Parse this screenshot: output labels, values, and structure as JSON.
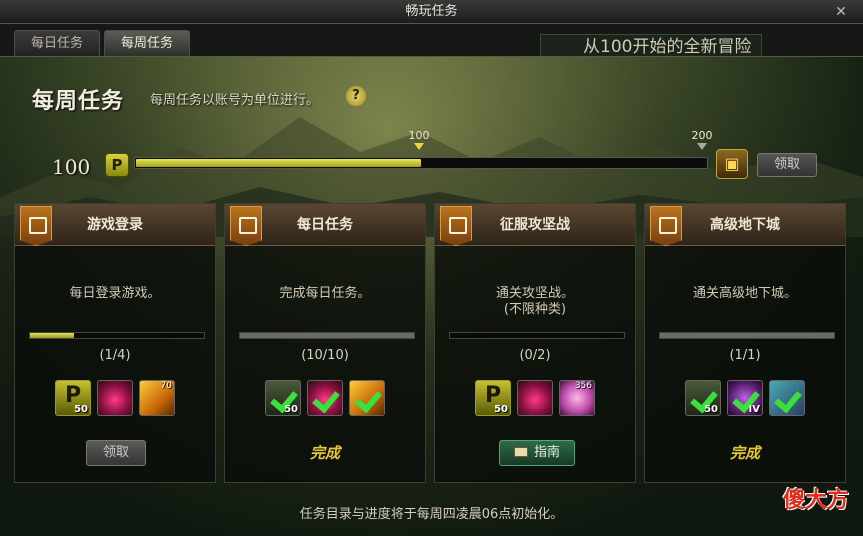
{
  "window": {
    "title": "畅玩任务",
    "close_glyph": "✕"
  },
  "tabs": [
    {
      "label": "每日任务"
    },
    {
      "label": "每周任务"
    }
  ],
  "banner_fragment": "从100开始的全新冒险",
  "weekly": {
    "heading": "每周任务",
    "subtitle": "每周任务以账号为单位进行。",
    "help_glyph": "?",
    "progress_value": "100",
    "points_icon_text": "P",
    "progress_fraction": 0.5,
    "marker_100": "100",
    "marker_200": "200",
    "chest_glyph": "▣",
    "claim_label": "领取"
  },
  "cards": [
    {
      "title": "游戏登录",
      "desc_line1": "每日登录游戏。",
      "desc_line2": "",
      "count": "(1/4)",
      "progress": 0.25,
      "rewards": [
        {
          "type": "points",
          "qty": "50"
        },
        {
          "type": "gem",
          "qty": ""
        },
        {
          "type": "gold",
          "qty": "70"
        }
      ],
      "action_label": "领取"
    },
    {
      "title": "每日任务",
      "desc_line1": "完成每日任务。",
      "desc_line2": "",
      "count": "(10/10)",
      "progress": 1.0,
      "rewards": [
        {
          "type": "done",
          "qty": "50"
        },
        {
          "type": "done"
        },
        {
          "type": "done"
        }
      ],
      "action_label": "完成"
    },
    {
      "title": "征服攻坚战",
      "desc_line1": "通关攻坚战。",
      "desc_line2": "(不限种类)",
      "count": "(0/2)",
      "progress": 0.0,
      "rewards": [
        {
          "type": "points",
          "qty": "50"
        },
        {
          "type": "gem",
          "qty": ""
        },
        {
          "type": "pink",
          "qty": "356"
        }
      ],
      "action_label": "指南"
    },
    {
      "title": "高级地下城",
      "desc_line1": "通关高级地下城。",
      "desc_line2": "",
      "count": "(1/1)",
      "progress": 1.0,
      "rewards": [
        {
          "type": "done",
          "qty": "50"
        },
        {
          "type": "done",
          "qty": "IV"
        },
        {
          "type": "done"
        }
      ],
      "action_label": "完成"
    }
  ],
  "footer": "任务目录与进度将于每周四凌晨06点初始化。",
  "watermark": "傻大方",
  "colors": {
    "accent_yellow": "#e8e060",
    "complete_gold": "#e8c830",
    "guide_green": "#2e6a4a",
    "header_brown": "#5a4632"
  }
}
